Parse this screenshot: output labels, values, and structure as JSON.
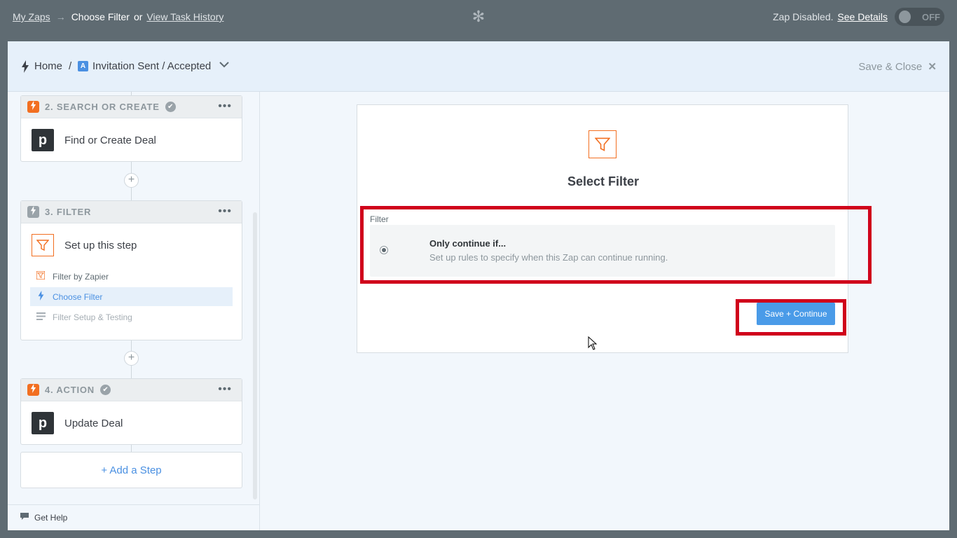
{
  "topbar": {
    "my_zaps": "My Zaps",
    "arrow": "→",
    "current": "Choose Filter",
    "or": "or",
    "task_history": "View Task History",
    "status_text": "Zap Disabled.",
    "see_details": "See Details",
    "toggle_label": "OFF"
  },
  "header": {
    "home": "Home",
    "separator": "/",
    "app_badge": "A",
    "zap_name": "Invitation Sent / Accepted",
    "save_close": "Save & Close"
  },
  "sidebar": {
    "steps": [
      {
        "number_label": "2. SEARCH OR CREATE",
        "title": "Find or Create Deal",
        "logo_letter": "p"
      },
      {
        "number_label": "3. FILTER",
        "title": "Set up this step",
        "substeps": [
          {
            "label": "Filter by Zapier",
            "icon": "filter-icon"
          },
          {
            "label": "Choose Filter",
            "icon": "bolt-icon"
          },
          {
            "label": "Filter Setup & Testing",
            "icon": "lines-icon"
          }
        ]
      },
      {
        "number_label": "4. ACTION",
        "title": "Update Deal",
        "logo_letter": "p"
      }
    ],
    "add_step": "+ Add a Step",
    "get_help": "Get Help"
  },
  "panel": {
    "title": "Select Filter",
    "field_label": "Filter",
    "option_title": "Only continue if...",
    "option_desc": "Set up rules to specify when this Zap can continue running.",
    "save_button": "Save + Continue"
  },
  "colors": {
    "accent": "#4a90e2",
    "brand_orange": "#f26f21",
    "highlight": "#d0021b"
  }
}
